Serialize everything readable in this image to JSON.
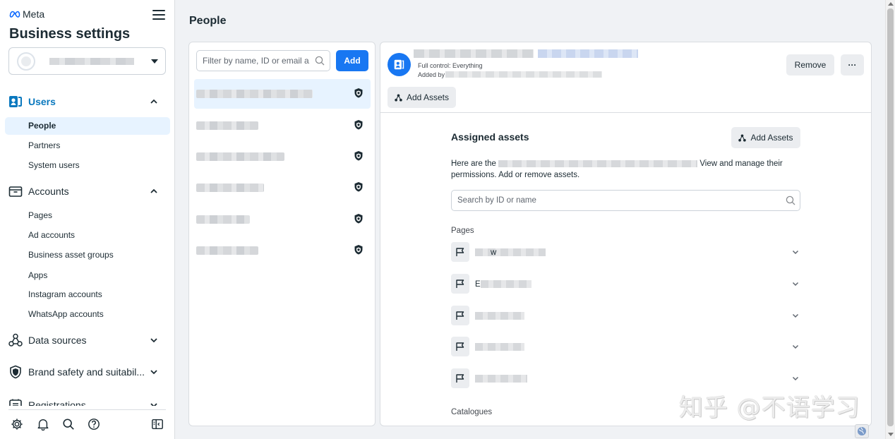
{
  "brand": {
    "name": "Meta"
  },
  "sidebar": {
    "title": "Business settings",
    "sections": {
      "users": "Users",
      "accounts": "Accounts",
      "data_sources": "Data sources",
      "brand_safety": "Brand safety and suitabil...",
      "registrations": "Registrations"
    },
    "user_items": [
      "People",
      "Partners",
      "System users"
    ],
    "account_items": [
      "Pages",
      "Ad accounts",
      "Business asset groups",
      "Apps",
      "Instagram accounts",
      "WhatsApp accounts"
    ]
  },
  "main": {
    "title": "People",
    "filter_placeholder": "Filter by name, ID or email a...",
    "add_label": "Add"
  },
  "detail": {
    "access": "Full control: Everything",
    "added_by": "Added by",
    "remove_label": "Remove",
    "more_label": "···",
    "add_assets_label": "Add Assets",
    "assigned_title": "Assigned assets",
    "desc_prefix": "Here are the",
    "desc_suffix": "View and manage their",
    "desc_line2": "permissions. Add or remove assets.",
    "search_placeholder": "Search by ID or name",
    "pages_label": "Pages",
    "pages": [
      "",
      "w",
      "E",
      "",
      ""
    ],
    "catalogues_label": "Catalogues"
  },
  "watermark": "知乎 @不语学习",
  "colors": {
    "accent": "#1877f2",
    "active_nav_bg": "#e7f3ff",
    "users_heading": "#0a78be"
  },
  "icons": [
    "meta-logo-icon",
    "hamburger-menu-icon",
    "users-icon",
    "briefcase-icon",
    "data-sources-icon",
    "shield-icon",
    "registrations-icon",
    "gear-icon",
    "bell-icon",
    "search-icon",
    "help-icon",
    "panel-toggle-icon",
    "flag-icon",
    "chevron-down-icon",
    "globe-icon"
  ]
}
